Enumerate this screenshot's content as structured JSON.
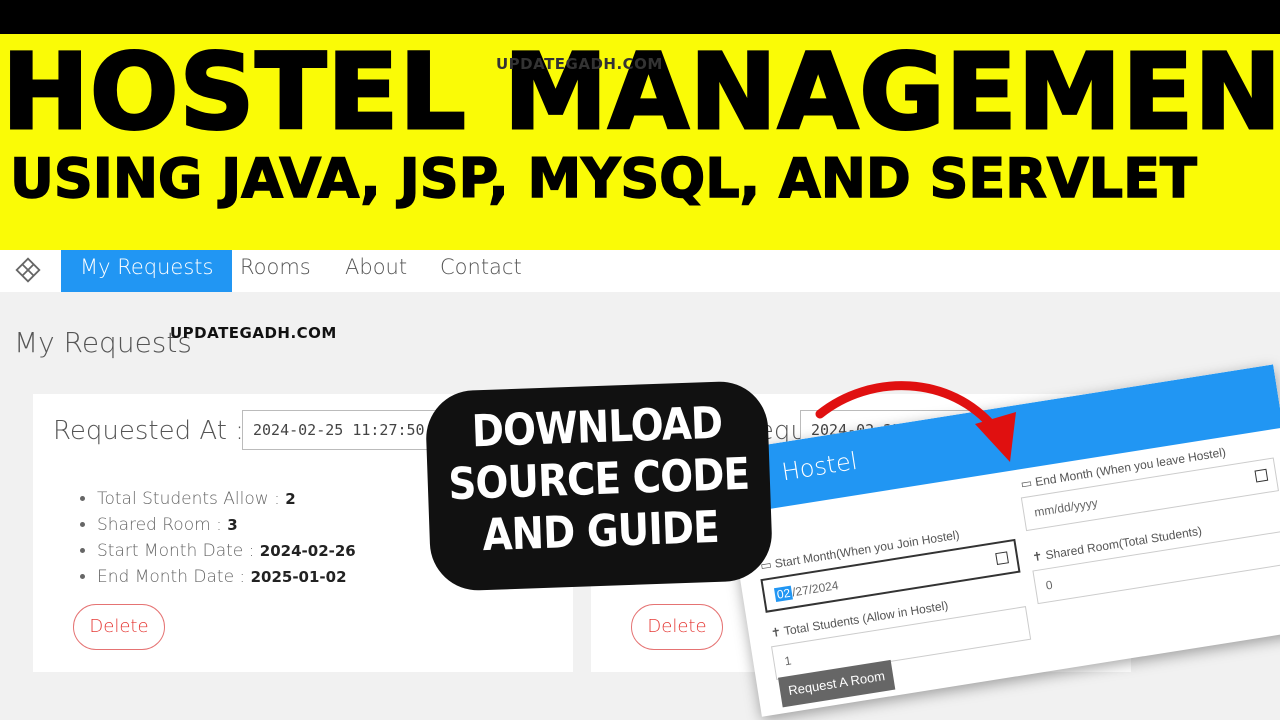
{
  "banner": {
    "title": "HOSTEL MANAGEMENT",
    "subtitle": "USING JAVA, JSP, MYSQL, AND SERVLET",
    "watermark_top": "UPDATEGADH.COM",
    "watermark_mid": "UPDATEGADH.COM",
    "colors": {
      "banner_bg": "#fafb06",
      "accent": "#2196f3",
      "delete": "#e53935"
    }
  },
  "nav": {
    "logo_icon": "diamond-grid-icon",
    "items": [
      {
        "label": "My Requests",
        "active": true
      },
      {
        "label": "Rooms"
      },
      {
        "label": "About"
      },
      {
        "label": "Contact"
      }
    ]
  },
  "page": {
    "title": "My Requests",
    "cards": [
      {
        "requested_label": "Requested At :",
        "requested_value": "2024-02-25 11:27:50.0",
        "items": [
          {
            "label": "Total Students Allow : ",
            "value": "2"
          },
          {
            "label": "Shared Room : ",
            "value": "3"
          },
          {
            "label": "Start Month Date : ",
            "value": "2024-02-26"
          },
          {
            "label": "End Month Date : ",
            "value": "2025-01-02"
          }
        ],
        "delete_label": "Delete"
      },
      {
        "requested_label": "Requested At :",
        "requested_value": "2024-02-25 11:27:50.0",
        "delete_label": "Delete"
      }
    ]
  },
  "badge": {
    "line1": "DOWNLOAD",
    "line2": "SOURCE CODE",
    "line3": "AND GUIDE"
  },
  "popup": {
    "title": "Hostel",
    "start_label": "Start Month(When you Join Hostel)",
    "start_value_sel": "02",
    "start_value_rest": "/27/2024",
    "end_label": "End Month (When you leave Hostel)",
    "end_placeholder": "mm/dd/yyyy",
    "total_label": "Total Students (Allow in Hostel)",
    "total_value": "1",
    "shared_label": "Shared Room(Total Students)",
    "shared_value": "0",
    "submit_label": "Request A Room"
  }
}
